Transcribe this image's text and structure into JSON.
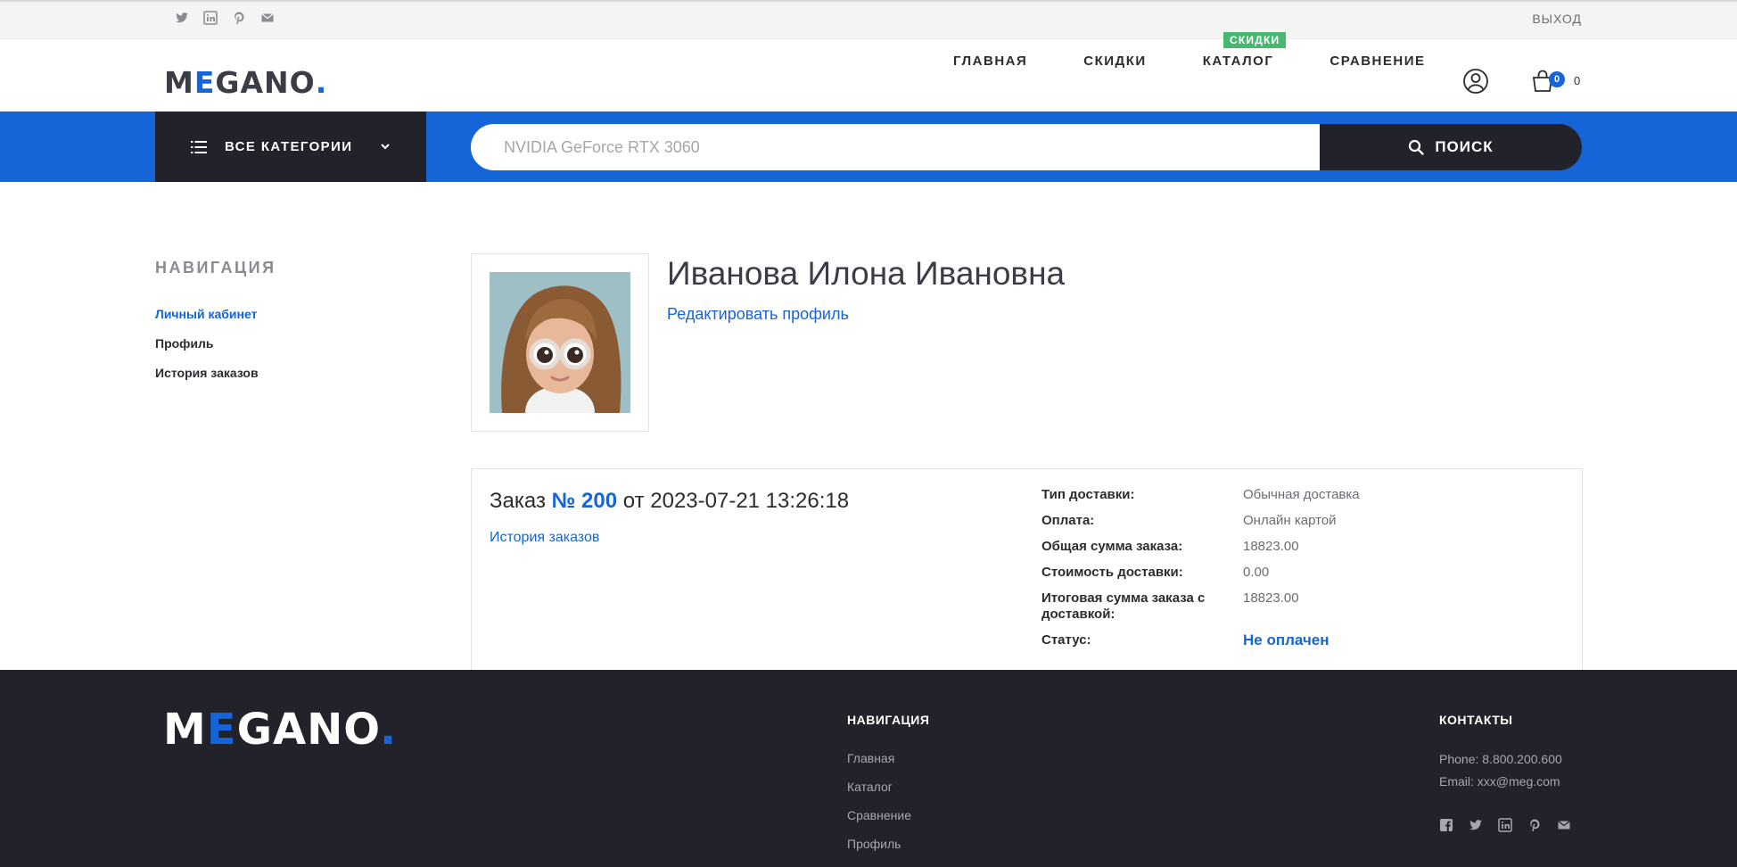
{
  "topbar": {
    "socials": [
      "twitter-icon",
      "linkedin-icon",
      "pinterest-icon",
      "mail-icon"
    ],
    "logout_label": "ВЫХОД"
  },
  "header": {
    "logo_main": "M",
    "logo_e": "E",
    "logo_rest": "GANO",
    "logo_dot": ".",
    "nav": [
      "ГЛАВНАЯ",
      "СКИДКИ",
      "КАТАЛОГ",
      "СРАВНЕНИЕ"
    ],
    "sale_badge": "СКИДКИ",
    "cart_count": "0",
    "cart_total": "0"
  },
  "search": {
    "categories_label": "ВСЕ КАТЕГОРИИ",
    "placeholder": "NVIDIA GeForce RTX 3060",
    "button_label": "ПОИСК"
  },
  "sidebar": {
    "title": "НАВИГАЦИЯ",
    "items": [
      {
        "label": "Личный кабинет",
        "active": true
      },
      {
        "label": "Профиль",
        "active": false
      },
      {
        "label": "История заказов",
        "active": false
      }
    ]
  },
  "profile": {
    "name": "Иванова Илона Ивановна",
    "edit_label": "Редактировать профиль"
  },
  "order": {
    "prefix": "Заказ",
    "number": "№ 200",
    "date_text": "от 2023-07-21 13:26:18",
    "history_link": "История заказов",
    "details": [
      {
        "label": "Тип доставки:",
        "value": "Обычная доставка"
      },
      {
        "label": "Оплата:",
        "value": "Онлайн картой"
      },
      {
        "label": "Общая сумма заказа:",
        "value": "18823.00"
      },
      {
        "label": "Стоимость доставки:",
        "value": "0.00"
      },
      {
        "label": "Итоговая сумма заказа с доставкой:",
        "value": "18823.00"
      },
      {
        "label": "Статус:",
        "value": "Не оплачен"
      }
    ]
  },
  "footer": {
    "nav_title": "НАВИГАЦИЯ",
    "nav": [
      "Главная",
      "Каталог",
      "Сравнение",
      "Профиль"
    ],
    "contacts_title": "КОНТАКТЫ",
    "phone": "Phone: 8.800.200.600",
    "email": "Email: xxx@meg.com",
    "socials": [
      "facebook-icon",
      "twitter-icon",
      "linkedin-icon",
      "pinterest-icon",
      "mail-icon"
    ]
  },
  "colors": {
    "accent": "#1565d8",
    "dark": "#22232a",
    "sale": "#46b970"
  }
}
